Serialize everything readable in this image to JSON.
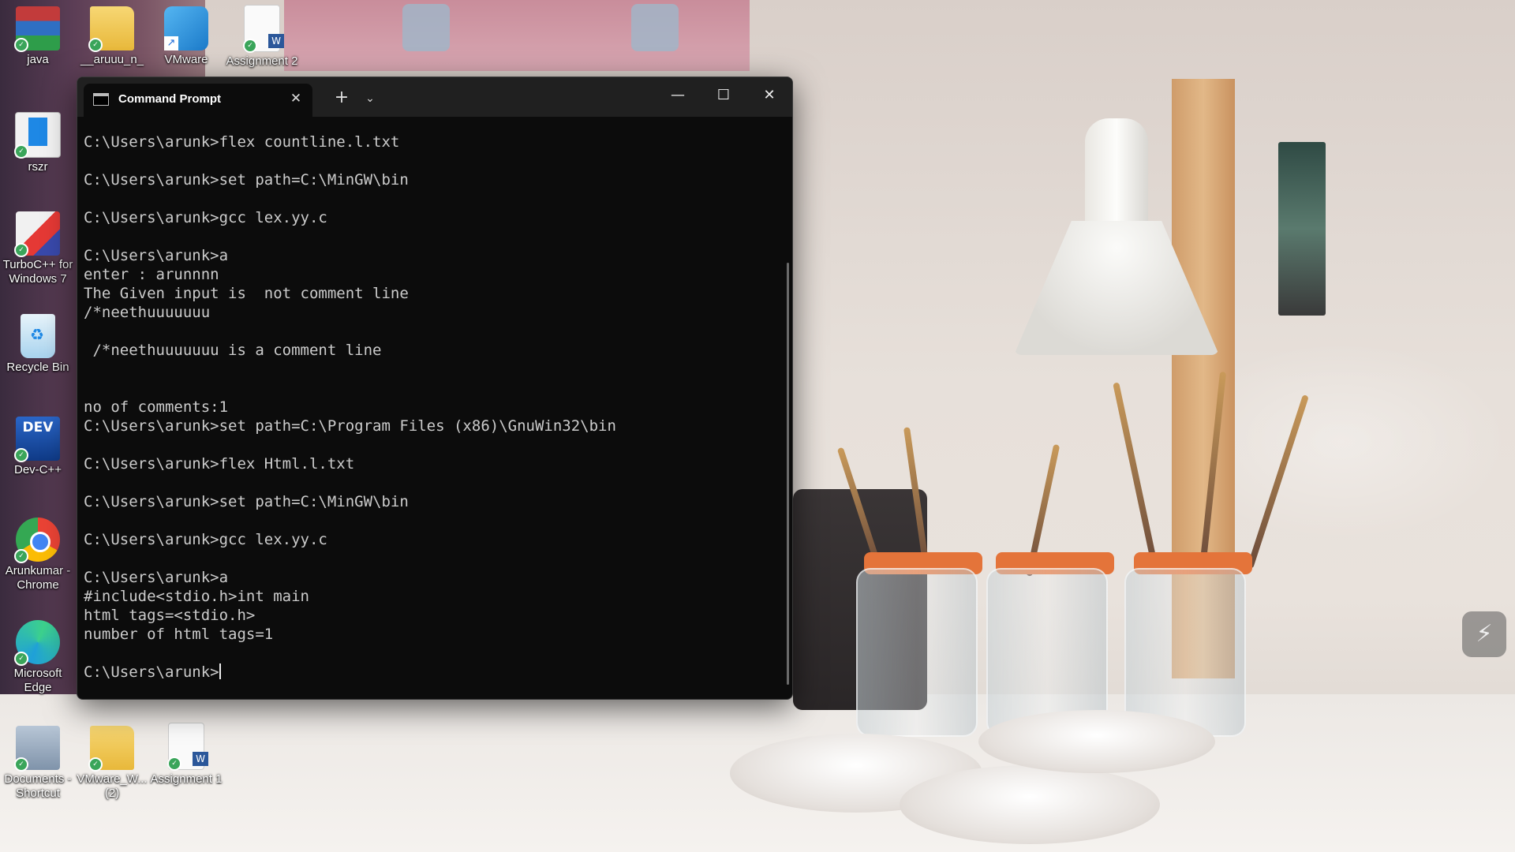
{
  "desktop": {
    "icons": [
      {
        "label": "java",
        "icon": "winrar-icon",
        "color": "#7a2e86"
      },
      {
        "label": "__aruuu_n_",
        "icon": "folder-icon",
        "color": "#f2c84b"
      },
      {
        "label": "VMware",
        "icon": "vmware-icon",
        "color": "#2a8ed6"
      },
      {
        "label": "Assignment 2",
        "icon": "word-document-icon",
        "color": "#2b579a"
      },
      {
        "label": "rszr",
        "icon": "app-icon",
        "color": "#1e88e5"
      },
      {
        "label": "TurboC++ for Windows 7",
        "icon": "turbo-cpp-icon",
        "color": "#e53935"
      },
      {
        "label": "Recycle Bin",
        "icon": "recycle-bin-icon",
        "color": "#9ecfee"
      },
      {
        "label": "Dev-C++",
        "icon": "dev-cpp-icon",
        "color": "#1d4e9e"
      },
      {
        "label": "Arunkumar - Chrome",
        "icon": "chrome-icon",
        "color": "#4285f4"
      },
      {
        "label": "Microsoft Edge",
        "icon": "edge-icon",
        "color": "#1fa0d8"
      },
      {
        "label": "Documents - Shortcut",
        "icon": "documents-icon",
        "color": "#8aa0b8"
      },
      {
        "label": "VMware_W... (2)",
        "icon": "folder-icon",
        "color": "#f2c84b"
      },
      {
        "label": "Assignment 1",
        "icon": "word-document-icon",
        "color": "#2b579a"
      }
    ]
  },
  "window": {
    "tab_title": "Command Prompt",
    "tab_close": "✕",
    "new_tab": "+",
    "dropdown": "⌄",
    "minimize": "—",
    "maximize": "☐",
    "close": "✕"
  },
  "terminal": {
    "lines": [
      "C:\\Users\\arunk>flex countline.l.txt",
      "",
      "C:\\Users\\arunk>set path=C:\\MinGW\\bin",
      "",
      "C:\\Users\\arunk>gcc lex.yy.c",
      "",
      "C:\\Users\\arunk>a",
      "enter : arunnnn",
      "The Given input is  not comment line",
      "/*neethuuuuuuu",
      "",
      " /*neethuuuuuuu is a comment line",
      "",
      "",
      "no of comments:1",
      "C:\\Users\\arunk>set path=C:\\Program Files (x86)\\GnuWin32\\bin",
      "",
      "C:\\Users\\arunk>flex Html.l.txt",
      "",
      "C:\\Users\\arunk>set path=C:\\MinGW\\bin",
      "",
      "C:\\Users\\arunk>gcc lex.yy.c",
      "",
      "C:\\Users\\arunk>a",
      "#include<stdio.h>int main",
      "html tags=<stdio.h>",
      "number of html tags=1",
      ""
    ],
    "prompt": "C:\\Users\\arunk>"
  },
  "floating_button": {
    "icon": "pen-icon",
    "glyph": "⚡"
  }
}
